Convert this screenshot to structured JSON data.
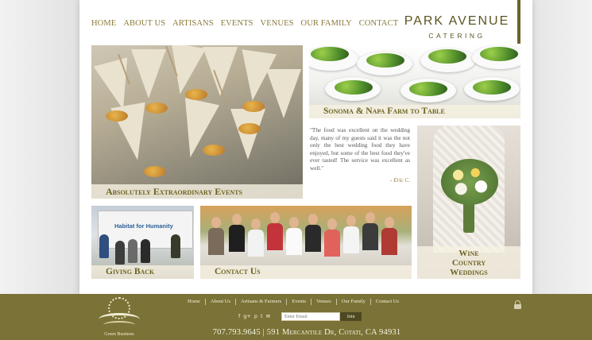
{
  "nav": {
    "items": [
      "HOME",
      "ABOUT US",
      "ARTISANS",
      "EVENTS",
      "VENUES",
      "OUR FAMILY",
      "CONTACT"
    ]
  },
  "logo": {
    "line1": "PARK AVENUE",
    "line2": "CATERING"
  },
  "tiles": {
    "events": "Absolutely Extraordinary Events",
    "farm": "Sonoma & Napa Farm to Table",
    "wedding": [
      "Wine",
      "Country",
      "Weddings"
    ],
    "giving": "Giving Back",
    "contact": "Contact Us",
    "habitat_text": "Habitat for Humanity"
  },
  "quote": {
    "text": "\"The food was excellent on the wedding day, many of my guests said it was the not only the best wedding food they have enjoyed, but some of the best food they've ever tasted! The service was excellent as well.\"",
    "author": "- Eric C."
  },
  "footer": {
    "nav": [
      "Home",
      "About Us",
      "Artisans & Farmers",
      "Events",
      "Venues",
      "Our Family",
      "Contact Us"
    ],
    "email_placeholder": "Enter Email",
    "join_label": "Join",
    "address": "707.793.9645 | 591 Mercantile Dr, Cotati, CA 94931",
    "badge_text": "Green Business",
    "social_icons": [
      "facebook-icon",
      "google-plus-icon",
      "pinterest-icon",
      "twitter-icon",
      "email-icon"
    ]
  },
  "colors": {
    "accent": "#8a7a3a",
    "footer_bg": "#7a7236",
    "logo_bar": "#6b6326"
  }
}
